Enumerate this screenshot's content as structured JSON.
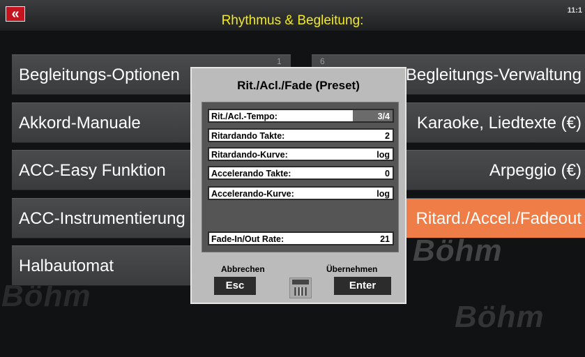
{
  "header": {
    "back_symbol": "«",
    "title": "Rhythmus & Begleitung:",
    "clock": "11:1"
  },
  "watermark": "Böhm",
  "menu": {
    "left": [
      {
        "label": "Begleitungs-Optionen",
        "num": "1"
      },
      {
        "label": "Akkord-Manuale"
      },
      {
        "label": "ACC-Easy Funktion"
      },
      {
        "label": "ACC-Instrumentierung"
      },
      {
        "label": "Halbautomat"
      }
    ],
    "right": [
      {
        "label": "Begleitungs-Verwaltung",
        "num": "6"
      },
      {
        "label": "Karaoke, Liedtexte (€)"
      },
      {
        "label": "Arpeggio (€)"
      },
      {
        "label": "Ritard./Accel./Fadeout",
        "active": true
      }
    ]
  },
  "dialog": {
    "title": "Rit./Acl./Fade (Preset)",
    "fields": [
      {
        "label": "Rit./Acl.-Tempo:",
        "value": "3/4"
      },
      {
        "label": "Ritardando Takte:",
        "value": "2"
      },
      {
        "label": "Ritardando-Kurve:",
        "value": "log"
      },
      {
        "label": "Accelerando Takte:",
        "value": "0"
      },
      {
        "label": "Accelerando-Kurve:",
        "value": "log"
      },
      {
        "label": "Fade-In/Out Rate:",
        "value": "21"
      }
    ],
    "cancel_label": "Abbrechen",
    "cancel_key": "Esc",
    "confirm_label": "Übernehmen",
    "confirm_key": "Enter",
    "keyboard_icon": "keyboard-icon"
  }
}
